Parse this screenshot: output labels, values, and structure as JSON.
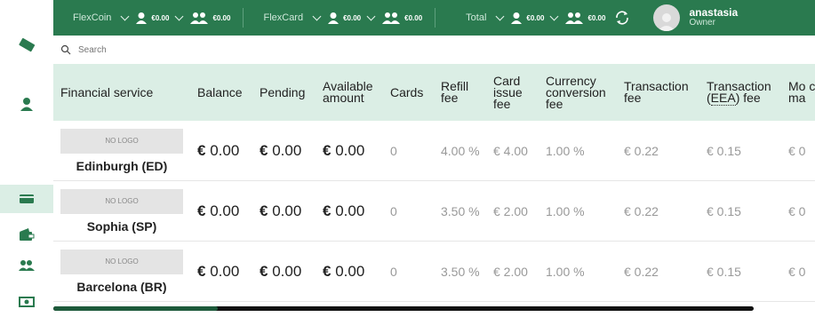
{
  "topbar": {
    "flexcoin": {
      "label": "FlexCoin",
      "single": "€0.00",
      "group": "€0.00"
    },
    "flexcard": {
      "label": "FlexCard",
      "single": "€0.00",
      "group": "€0.00"
    },
    "total": {
      "label": "Total",
      "single": "€0.00",
      "group": "€0.00"
    },
    "user": {
      "name": "anastasia",
      "role": "Owner"
    }
  },
  "search": {
    "placeholder": "Search"
  },
  "table": {
    "headers": [
      "Financial service",
      "Balance",
      "Pending",
      "Available amount",
      "Cards",
      "Refill fee",
      "Card issue fee",
      "Currency conversion fee",
      "Transaction fee",
      "Transaction (EEA) fee",
      "Mo car ma"
    ],
    "rows": [
      {
        "logo": "NO LOGO",
        "name": "Edinburgh (ED)",
        "balance": "0.00",
        "pending": "0.00",
        "available": "0.00",
        "cards": "0",
        "refill": "4.00 %",
        "issue": "€ 4.00",
        "conversion": "1.00 %",
        "tx": "€ 0.22",
        "tx_eea": "€ 0.15",
        "more": "€ 0"
      },
      {
        "logo": "NO LOGO",
        "name": "Sophia (SP)",
        "balance": "0.00",
        "pending": "0.00",
        "available": "0.00",
        "cards": "0",
        "refill": "3.50 %",
        "issue": "€ 2.00",
        "conversion": "1.00 %",
        "tx": "€ 0.22",
        "tx_eea": "€ 0.15",
        "more": "€ 0"
      },
      {
        "logo": "NO LOGO",
        "name": "Barcelona (BR)",
        "balance": "0.00",
        "pending": "0.00",
        "available": "0.00",
        "cards": "0",
        "refill": "3.50 %",
        "issue": "€ 2.00",
        "conversion": "1.00 %",
        "tx": "€ 0.22",
        "tx_eea": "€ 0.15",
        "more": "€ 0"
      }
    ]
  },
  "colors": {
    "brand": "#2a7a4f",
    "header_bg": "#dbeee5"
  }
}
